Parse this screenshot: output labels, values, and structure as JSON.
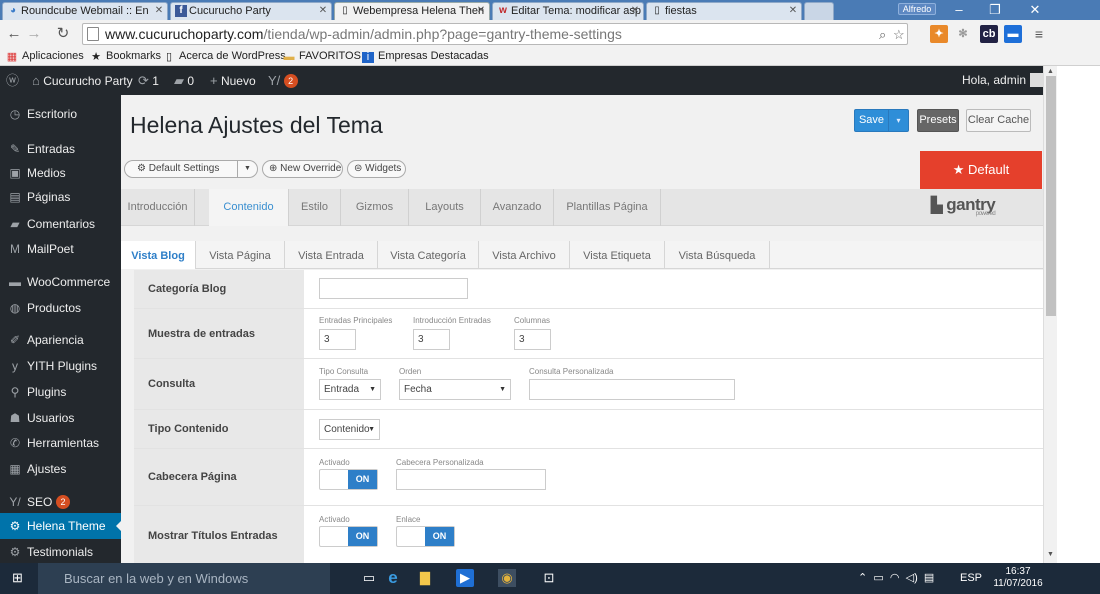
{
  "browser": {
    "tabs": [
      {
        "title": "Roundcube Webmail :: En",
        "icon": "roundcube-icon"
      },
      {
        "title": "Cucurucho Party",
        "icon": "facebook-icon"
      },
      {
        "title": "Webempresa Helena Then",
        "icon": "page-icon"
      },
      {
        "title": "Editar Tema: modificar asp",
        "icon": "webempresa-icon"
      },
      {
        "title": "fiestas",
        "icon": "page-icon"
      }
    ],
    "profile": "Alfredo",
    "url_host": "www.cucuruchoparty.com",
    "url_path": "/tienda/wp-admin/admin.php?page=gantry-theme-settings",
    "bookmarks": [
      "Aplicaciones",
      "Bookmarks",
      "Acerca de WordPress",
      "FAVORITOS",
      "Empresas Destacadas"
    ]
  },
  "adminbar": {
    "site": "Cucurucho Party",
    "updates": "1",
    "comments": "0",
    "new": "Nuevo",
    "plugin_badge": "2",
    "greeting": "Hola, admin"
  },
  "sidebar": {
    "items": [
      {
        "label": "Escritorio",
        "icon": "dashboard-icon"
      },
      {
        "label": "Entradas",
        "icon": "pin-icon"
      },
      {
        "label": "Medios",
        "icon": "media-icon"
      },
      {
        "label": "Páginas",
        "icon": "pages-icon"
      },
      {
        "label": "Comentarios",
        "icon": "comments-icon"
      },
      {
        "label": "MailPoet",
        "icon": "mailpoet-icon"
      },
      {
        "label": "WooCommerce",
        "icon": "woocommerce-icon"
      },
      {
        "label": "Productos",
        "icon": "products-icon"
      },
      {
        "label": "Apariencia",
        "icon": "appearance-icon"
      },
      {
        "label": "YITH Plugins",
        "icon": "yith-icon"
      },
      {
        "label": "Plugins",
        "icon": "plugins-icon"
      },
      {
        "label": "Usuarios",
        "icon": "users-icon"
      },
      {
        "label": "Herramientas",
        "icon": "tools-icon"
      },
      {
        "label": "Ajustes",
        "icon": "settings-icon"
      },
      {
        "label": "SEO",
        "icon": "seo-icon",
        "badge": "2"
      },
      {
        "label": "Helena Theme",
        "icon": "theme-gear-icon",
        "active": true
      },
      {
        "label": "Testimonials",
        "icon": "testimonials-icon"
      }
    ]
  },
  "page": {
    "title": "Helena Ajustes del Tema",
    "save": "Save",
    "presets": "Presets",
    "clear_cache": "Clear Cache",
    "default_settings": "Default Settings",
    "new_override": "New Override",
    "widgets": "Widgets",
    "default_tab": "★ Default",
    "brand": "gantry",
    "brand_sub": "powered"
  },
  "nav": {
    "tabs": [
      "Introducción",
      "Contenido",
      "Estilo",
      "Gizmos",
      "Layouts",
      "Avanzado",
      "Plantillas Página"
    ],
    "active": 1
  },
  "subnav": {
    "tabs": [
      "Vista Blog",
      "Vista Página",
      "Vista Entrada",
      "Vista Categoría",
      "Vista Archivo",
      "Vista Etiqueta",
      "Vista Búsqueda"
    ],
    "active": 0
  },
  "form": {
    "categoria_blog": {
      "label": "Categoría Blog",
      "value": ""
    },
    "muestra": {
      "label": "Muestra de entradas",
      "principales_label": "Entradas Principales",
      "principales": "3",
      "introduccion_label": "Introducción Entradas",
      "introduccion": "3",
      "columnas_label": "Columnas",
      "columnas": "3"
    },
    "consulta": {
      "label": "Consulta",
      "tipo_label": "Tipo Consulta",
      "tipo": "Entrada",
      "orden_label": "Orden",
      "orden": "Fecha",
      "personalizada_label": "Consulta Personalizada",
      "personalizada": ""
    },
    "tipo_contenido": {
      "label": "Tipo Contenido",
      "value": "Contenido"
    },
    "cabecera": {
      "label": "Cabecera Página",
      "activado_label": "Activado",
      "activado": "ON",
      "personalizada_label": "Cabecera Personalizada",
      "personalizada": ""
    },
    "titulos": {
      "label": "Mostrar Títulos Entradas",
      "activado_label": "Activado",
      "activado": "ON",
      "enlace_label": "Enlace",
      "enlace": "ON"
    }
  },
  "taskbar": {
    "search": "Buscar en la web y en Windows",
    "lang": "ESP",
    "time": "16:37",
    "date": "11/07/2016"
  }
}
